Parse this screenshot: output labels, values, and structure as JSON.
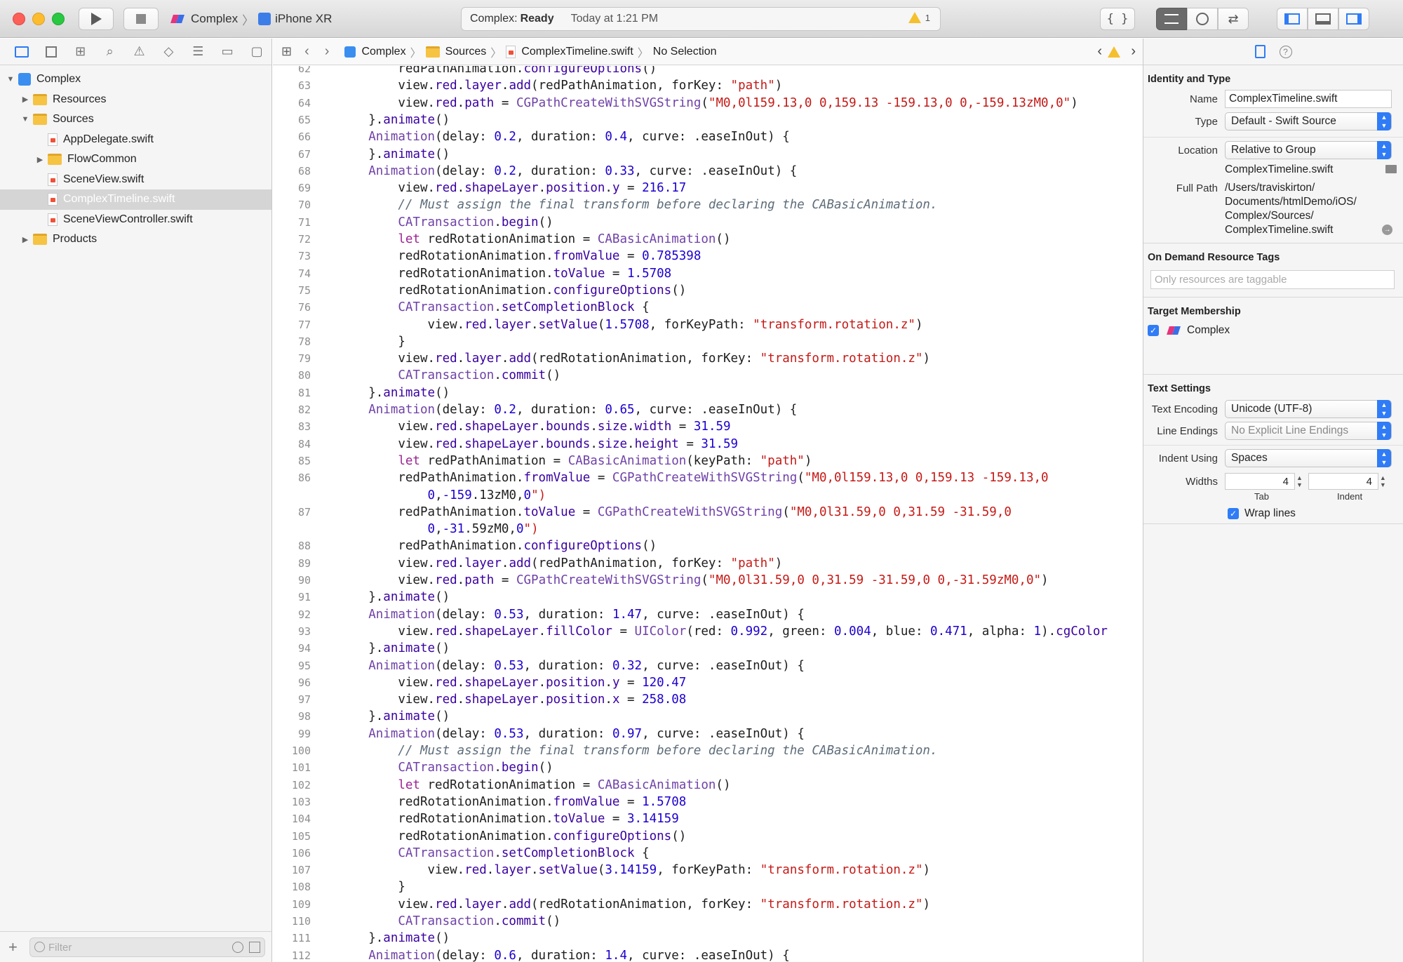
{
  "toolbar": {
    "scheme_name": "Complex",
    "scheme_sep": "〉",
    "device_name": "iPhone XR",
    "activity_status_prefix": "Complex:",
    "activity_status": "Ready",
    "activity_time": "Today at 1:21 PM",
    "warning_count": "1"
  },
  "navigator": {
    "tabs": [
      "folder-icon",
      "source-control-icon",
      "symbol-icon",
      "find-icon",
      "issue-icon",
      "test-icon",
      "debug-icon",
      "breakpoint-icon",
      "report-icon"
    ],
    "tree": [
      {
        "label": "Complex",
        "type": "project",
        "depth": 0,
        "disclosure": "▼"
      },
      {
        "label": "Resources",
        "type": "folder",
        "depth": 1,
        "disclosure": "▶"
      },
      {
        "label": "Sources",
        "type": "folder",
        "depth": 1,
        "disclosure": "▼"
      },
      {
        "label": "AppDelegate.swift",
        "type": "swift",
        "depth": 2,
        "disclosure": ""
      },
      {
        "label": "FlowCommon",
        "type": "folder",
        "depth": 2,
        "disclosure": "▶"
      },
      {
        "label": "SceneView.swift",
        "type": "swift",
        "depth": 2,
        "disclosure": ""
      },
      {
        "label": "ComplexTimeline.swift",
        "type": "swift",
        "depth": 2,
        "disclosure": "",
        "selected": true
      },
      {
        "label": "SceneViewController.swift",
        "type": "swift",
        "depth": 2,
        "disclosure": ""
      },
      {
        "label": "Products",
        "type": "folder",
        "depth": 1,
        "disclosure": "▶"
      }
    ],
    "filter_placeholder": "Filter"
  },
  "jumpbar": {
    "project": "Complex",
    "group": "Sources",
    "file": "ComplexTimeline.swift",
    "selection": "No Selection"
  },
  "editor": {
    "lines": [
      {
        "n": "62",
        "text": "          redPathAnimation.configureOptions()"
      },
      {
        "n": "63",
        "text": "          view.red.layer.add(redPathAnimation, forKey: \"path\")"
      },
      {
        "n": "64",
        "text": "          view.red.path = CGPathCreateWithSVGString(\"M0,0l159.13,0 0,159.13 -159.13,0 0,-159.13zM0,0\")"
      },
      {
        "n": "65",
        "text": "      }.animate()"
      },
      {
        "n": "66",
        "text": "      Animation(delay: 0.2, duration: 0.4, curve: .easeInOut) {"
      },
      {
        "n": "67",
        "text": "      }.animate()"
      },
      {
        "n": "68",
        "text": "      Animation(delay: 0.2, duration: 0.33, curve: .easeInOut) {"
      },
      {
        "n": "69",
        "text": "          view.red.shapeLayer.position.y = 216.17"
      },
      {
        "n": "70",
        "text": "          // Must assign the final transform before declaring the CABasicAnimation."
      },
      {
        "n": "71",
        "text": "          CATransaction.begin()"
      },
      {
        "n": "72",
        "text": "          let redRotationAnimation = CABasicAnimation()"
      },
      {
        "n": "73",
        "text": "          redRotationAnimation.fromValue = 0.785398"
      },
      {
        "n": "74",
        "text": "          redRotationAnimation.toValue = 1.5708"
      },
      {
        "n": "75",
        "text": "          redRotationAnimation.configureOptions()"
      },
      {
        "n": "76",
        "text": "          CATransaction.setCompletionBlock {"
      },
      {
        "n": "77",
        "text": "              view.red.layer.setValue(1.5708, forKeyPath: \"transform.rotation.z\")"
      },
      {
        "n": "78",
        "text": "          }"
      },
      {
        "n": "79",
        "text": "          view.red.layer.add(redRotationAnimation, forKey: \"transform.rotation.z\")"
      },
      {
        "n": "80",
        "text": "          CATransaction.commit()"
      },
      {
        "n": "81",
        "text": "      }.animate()"
      },
      {
        "n": "82",
        "text": "      Animation(delay: 0.2, duration: 0.65, curve: .easeInOut) {"
      },
      {
        "n": "83",
        "text": "          view.red.shapeLayer.bounds.size.width = 31.59"
      },
      {
        "n": "84",
        "text": "          view.red.shapeLayer.bounds.size.height = 31.59"
      },
      {
        "n": "85",
        "text": "          let redPathAnimation = CABasicAnimation(keyPath: \"path\")"
      },
      {
        "n": "86",
        "text": "          redPathAnimation.fromValue = CGPathCreateWithSVGString(\"M0,0l159.13,0 0,159.13 -159.13,0"
      },
      {
        "n": "",
        "text": "              0,-159.13zM0,0\")"
      },
      {
        "n": "87",
        "text": "          redPathAnimation.toValue = CGPathCreateWithSVGString(\"M0,0l31.59,0 0,31.59 -31.59,0"
      },
      {
        "n": "",
        "text": "              0,-31.59zM0,0\")"
      },
      {
        "n": "88",
        "text": "          redPathAnimation.configureOptions()"
      },
      {
        "n": "89",
        "text": "          view.red.layer.add(redPathAnimation, forKey: \"path\")"
      },
      {
        "n": "90",
        "text": "          view.red.path = CGPathCreateWithSVGString(\"M0,0l31.59,0 0,31.59 -31.59,0 0,-31.59zM0,0\")"
      },
      {
        "n": "91",
        "text": "      }.animate()"
      },
      {
        "n": "92",
        "text": "      Animation(delay: 0.53, duration: 1.47, curve: .easeInOut) {"
      },
      {
        "n": "93",
        "text": "          view.red.shapeLayer.fillColor = UIColor(red: 0.992, green: 0.004, blue: 0.471, alpha: 1).cgColor"
      },
      {
        "n": "94",
        "text": "      }.animate()"
      },
      {
        "n": "95",
        "text": "      Animation(delay: 0.53, duration: 0.32, curve: .easeInOut) {"
      },
      {
        "n": "96",
        "text": "          view.red.shapeLayer.position.y = 120.47"
      },
      {
        "n": "97",
        "text": "          view.red.shapeLayer.position.x = 258.08"
      },
      {
        "n": "98",
        "text": "      }.animate()"
      },
      {
        "n": "99",
        "text": "      Animation(delay: 0.53, duration: 0.97, curve: .easeInOut) {"
      },
      {
        "n": "100",
        "text": "          // Must assign the final transform before declaring the CABasicAnimation."
      },
      {
        "n": "101",
        "text": "          CATransaction.begin()"
      },
      {
        "n": "102",
        "text": "          let redRotationAnimation = CABasicAnimation()"
      },
      {
        "n": "103",
        "text": "          redRotationAnimation.fromValue = 1.5708"
      },
      {
        "n": "104",
        "text": "          redRotationAnimation.toValue = 3.14159"
      },
      {
        "n": "105",
        "text": "          redRotationAnimation.configureOptions()"
      },
      {
        "n": "106",
        "text": "          CATransaction.setCompletionBlock {"
      },
      {
        "n": "107",
        "text": "              view.red.layer.setValue(3.14159, forKeyPath: \"transform.rotation.z\")"
      },
      {
        "n": "108",
        "text": "          }"
      },
      {
        "n": "109",
        "text": "          view.red.layer.add(redRotationAnimation, forKey: \"transform.rotation.z\")"
      },
      {
        "n": "110",
        "text": "          CATransaction.commit()"
      },
      {
        "n": "111",
        "text": "      }.animate()"
      },
      {
        "n": "112",
        "text": "      Animation(delay: 0.6, duration: 1.4, curve: .easeInOut) {"
      }
    ]
  },
  "inspector": {
    "identity_title": "Identity and Type",
    "name_label": "Name",
    "name_value": "ComplexTimeline.swift",
    "type_label": "Type",
    "type_value": "Default - Swift Source",
    "location_label": "Location",
    "location_value": "Relative to Group",
    "location_file": "ComplexTimeline.swift",
    "full_path_label": "Full Path",
    "full_path_lines": [
      "/Users/traviskirton/",
      "Documents/htmlDemo/iOS/",
      "Complex/Sources/",
      "ComplexTimeline.swift"
    ],
    "odr_title": "On Demand Resource Tags",
    "odr_placeholder": "Only resources are taggable",
    "target_title": "Target Membership",
    "target_name": "Complex",
    "text_title": "Text Settings",
    "encoding_label": "Text Encoding",
    "encoding_value": "Unicode (UTF-8)",
    "line_endings_label": "Line Endings",
    "line_endings_value": "No Explicit Line Endings",
    "indent_using_label": "Indent Using",
    "indent_using_value": "Spaces",
    "widths_label": "Widths",
    "tab_width": "4",
    "indent_width": "4",
    "tab_caption": "Tab",
    "indent_caption": "Indent",
    "wrap_label": "Wrap lines"
  }
}
